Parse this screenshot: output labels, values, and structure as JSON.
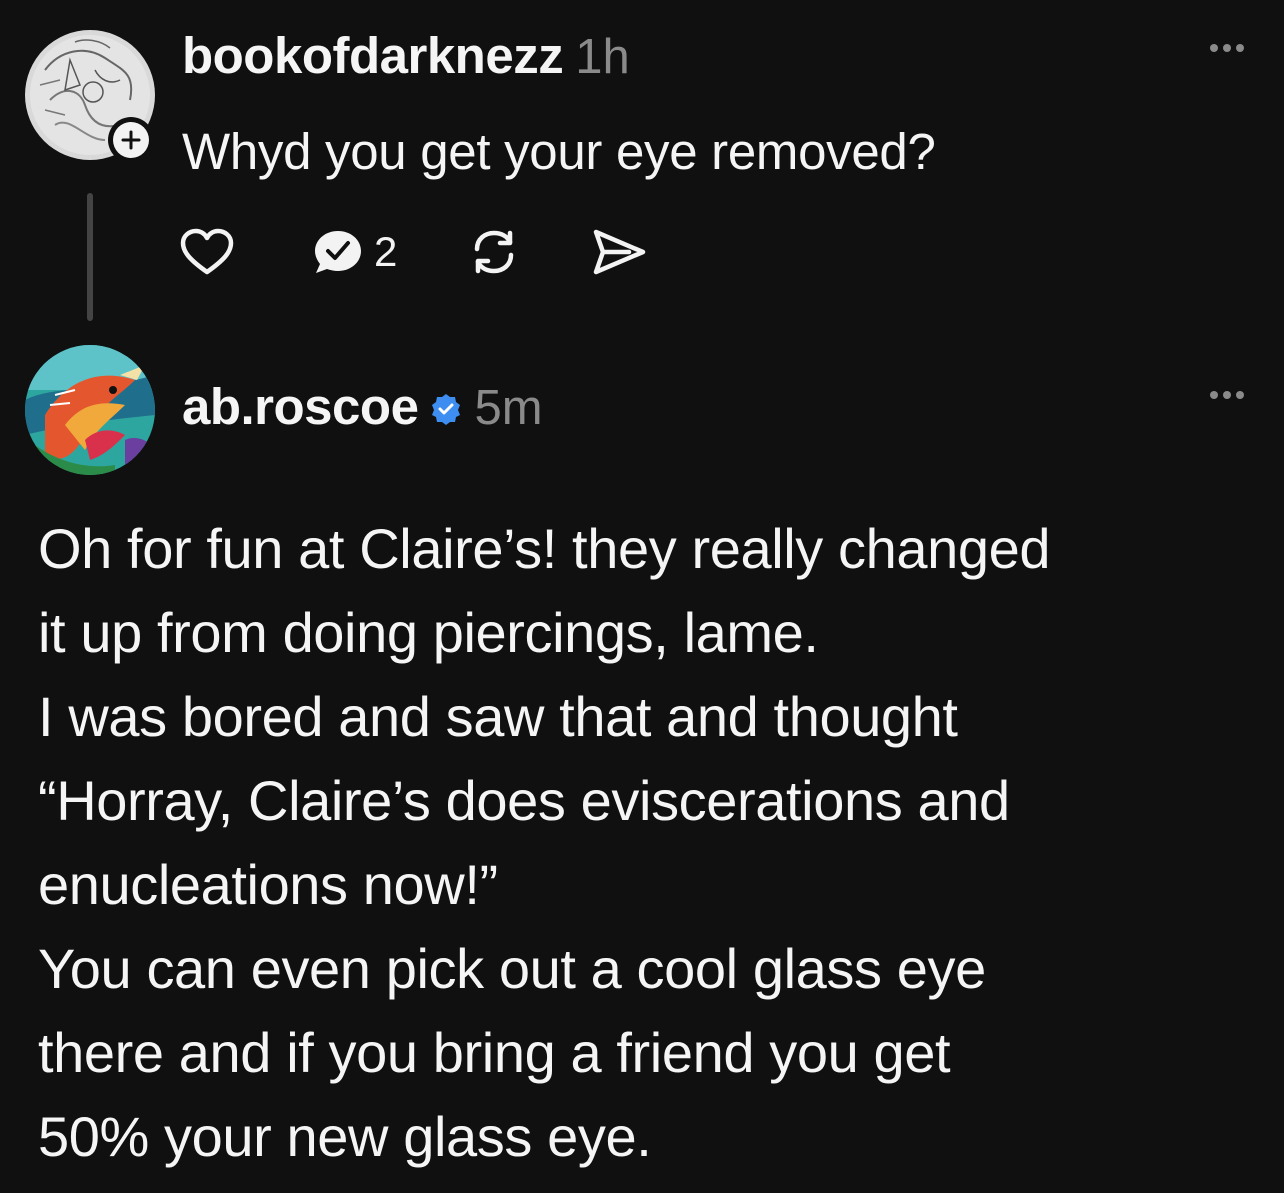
{
  "thread": {
    "parent": {
      "username": "bookofdarknezz",
      "time": "1h",
      "text": "Whyd you get your eye removed?",
      "reply_count": "2",
      "icons": {
        "avatar": "sketch-avatar",
        "follow": "plus-icon",
        "like": "heart-icon",
        "reply": "reply-bubble-icon",
        "repost": "repost-icon",
        "share": "send-icon",
        "more": "more-icon"
      }
    },
    "reply": {
      "username": "ab.roscoe",
      "time": "5m",
      "verified": true,
      "lines": [
        "Oh for fun at Claire’s! they really changed",
        "it up from doing piercings, lame.",
        "I was bored and saw that and thought",
        "“Horray, Claire’s does eviscerations and",
        "enucleations now!”",
        "You can even pick out a cool glass eye",
        "there and if you bring a friend you get",
        "50% your new glass eye."
      ],
      "icons": {
        "avatar": "painted-avatar",
        "verified": "verified-badge-icon",
        "more": "more-icon"
      }
    }
  },
  "colors": {
    "background": "#101010",
    "text": "#f5f5f5",
    "muted": "#8a8a8a",
    "verified_blue": "#3d8ef0"
  }
}
